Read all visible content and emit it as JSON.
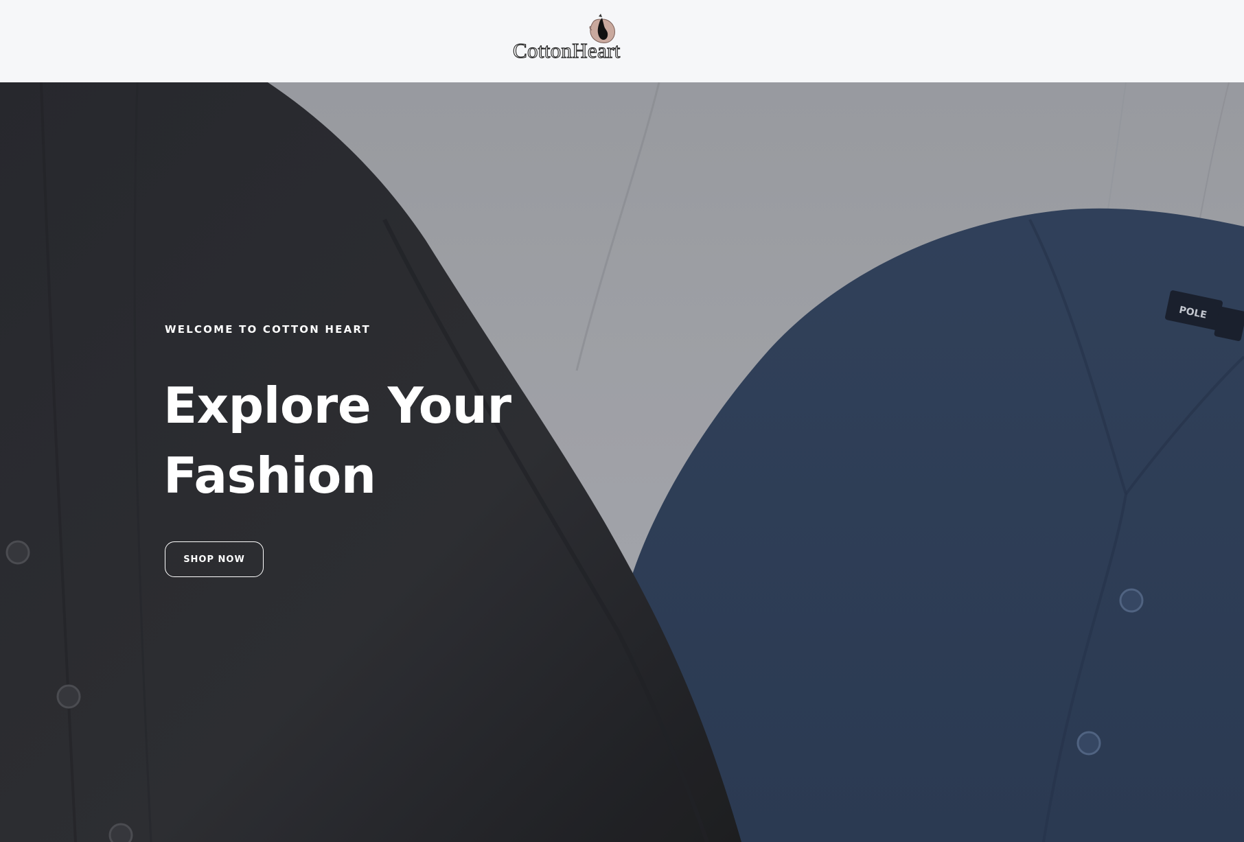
{
  "header": {
    "logo_text": "CottonHeart",
    "logo_icon": "cotton-heart-logo-icon"
  },
  "hero": {
    "eyebrow": "WELCOME TO COTTON HEART",
    "headline_line1": "Explore Your",
    "headline_line2": "Fashion",
    "cta_label": "SHOP NOW",
    "image_subject": "black cardigan and navy blue cardigan on grey background",
    "colors": {
      "background": "#a3a6ad",
      "black_garment": "#2c2d31",
      "navy_garment": "#33445f",
      "text": "#ffffff"
    }
  }
}
